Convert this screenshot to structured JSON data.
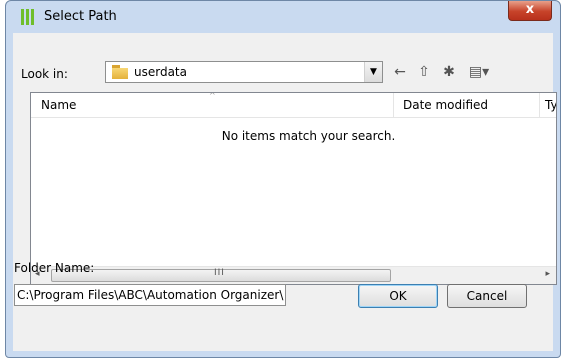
{
  "window": {
    "title": "Select Path",
    "close_glyph": "x"
  },
  "toolbar": {
    "look_in_label": "Look in:",
    "current_folder": "userdata",
    "dropdown_glyph": "▼",
    "back_glyph": "←",
    "up_folder_glyph": "⇧",
    "new_folder_glyph": "✱",
    "view_menu_glyph": "▤▾",
    "icons": [
      "folder-icon",
      "back-arrow-icon",
      "up-folder-icon",
      "new-folder-icon",
      "view-menu-icon"
    ]
  },
  "list": {
    "columns": [
      "Name",
      "Date modified",
      "Ty"
    ],
    "sort_glyph": "^",
    "empty_message": "No items match your search.",
    "scroll_left_glyph": "◂",
    "scroll_right_glyph": "▸",
    "grip_glyph": "III"
  },
  "form": {
    "folder_name_label": "Folder Name:",
    "folder_name_value": "C:\\Program Files\\ABC\\Automation Organizer\\"
  },
  "buttons": {
    "ok": "OK",
    "cancel": "Cancel"
  },
  "colors": {
    "titlebar": "#c9daf0",
    "close_button": "#c7432a",
    "app_icon": "#6fbe2a"
  }
}
